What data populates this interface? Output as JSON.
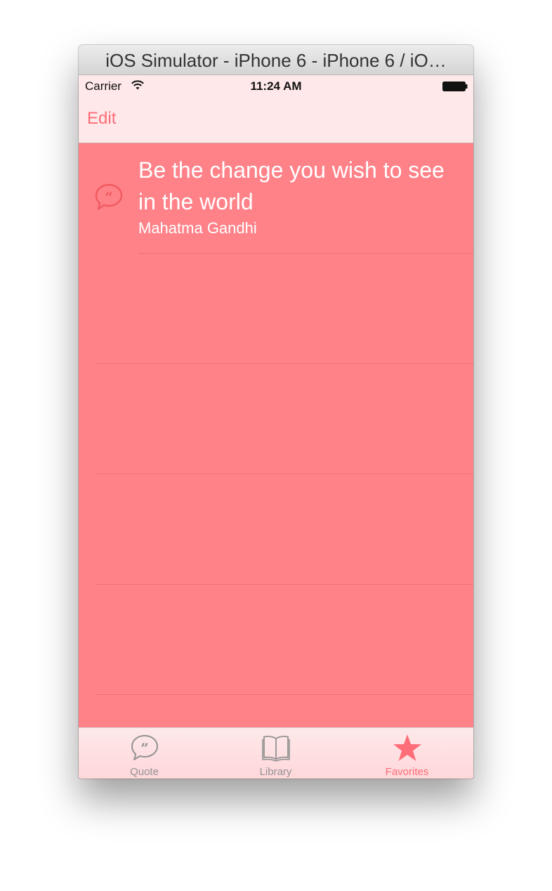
{
  "window": {
    "title": "iOS Simulator - iPhone 6 - iPhone 6 / iO…"
  },
  "status_bar": {
    "carrier": "Carrier",
    "time": "11:24 AM",
    "wifi_icon": "wifi-icon",
    "battery_icon": "battery-icon"
  },
  "nav": {
    "edit_label": "Edit"
  },
  "list": {
    "items": [
      {
        "icon": "quote-bubble-icon",
        "text": "Be the change you wish to see in the world",
        "author": "Mahatma Gandhi"
      }
    ]
  },
  "tab_bar": {
    "tabs": [
      {
        "label": "Quote",
        "icon": "quote-bubble-icon",
        "active": false
      },
      {
        "label": "Library",
        "icon": "book-icon",
        "active": false
      },
      {
        "label": "Favorites",
        "icon": "star-icon",
        "active": true
      }
    ]
  },
  "colors": {
    "background": "#ff8289",
    "bar_background": "#fee8e9",
    "accent": "#ff6d78",
    "inactive_tab": "#929292",
    "text": "#ffffff"
  }
}
